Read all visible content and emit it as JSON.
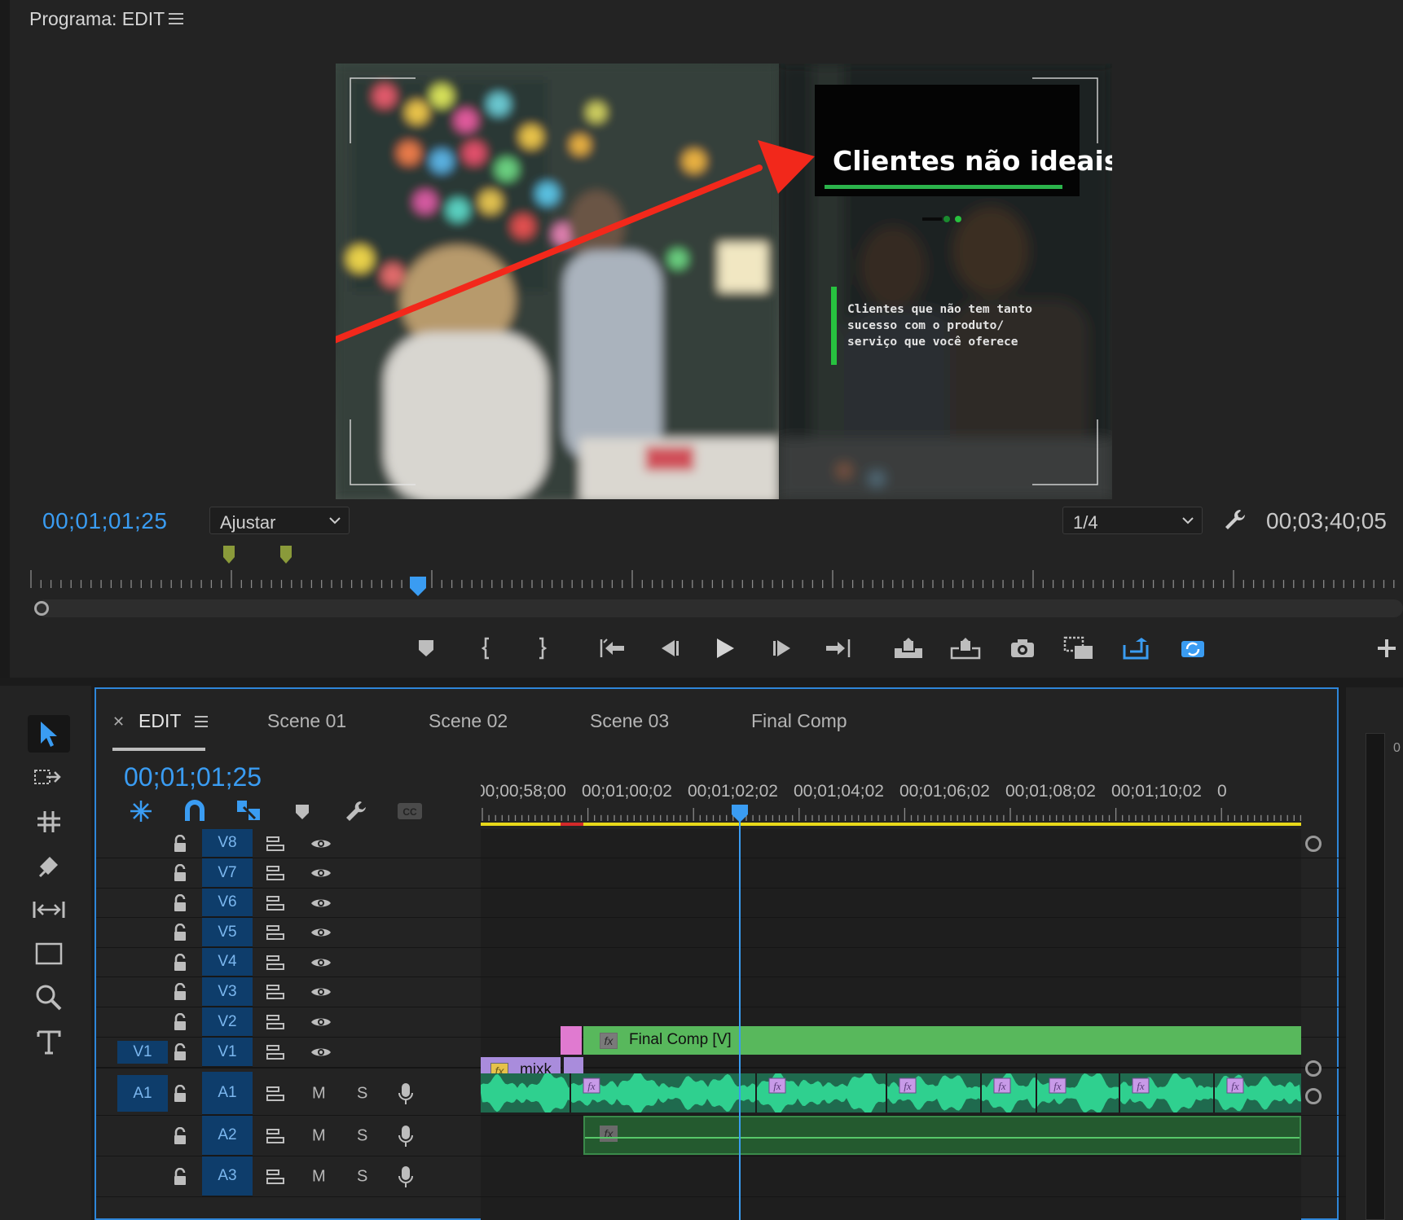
{
  "program": {
    "title": "Programa: EDIT",
    "overlay_title": "Clientes não ideais",
    "overlay_subtitle": "Clientes que não tem tanto\nsucesso com o produto/\nserviço que você oferece",
    "playhead_time": "00;01;01;25",
    "fit_option": "Ajustar",
    "resolution_option": "1/4",
    "duration_time": "00;03;40;05"
  },
  "transport_icons": [
    "add-marker-icon",
    "mark-in-icon",
    "mark-out-icon",
    "go-to-in-icon",
    "step-back-icon",
    "play-icon",
    "step-forward-icon",
    "go-to-out-icon",
    "lift-icon",
    "extract-icon",
    "export-frame-icon",
    "comparison-view-icon",
    "insert-icon",
    "overwrite-icon",
    "add-button-icon"
  ],
  "tools": [
    "selection-tool-icon",
    "track-select-tool-icon",
    "ripple-edit-tool-icon",
    "razor-tool-icon",
    "slip-tool-icon",
    "rectangle-tool-icon",
    "zoom-tool-icon",
    "type-tool-icon"
  ],
  "timeline": {
    "tabs": [
      "EDIT",
      "Scene 01",
      "Scene 02",
      "Scene 03",
      "Final Comp"
    ],
    "active_tab": "EDIT",
    "timecode": "00;01;01;25",
    "ruler_labels": [
      "00;00;58;00",
      "00;01;00;02",
      "00;01;02;02",
      "00;01;04;02",
      "00;01;06;02",
      "00;01;08;02",
      "00;01;10;02",
      "0"
    ],
    "video_tracks": [
      {
        "label": "V8"
      },
      {
        "label": "V7"
      },
      {
        "label": "V6"
      },
      {
        "label": "V5"
      },
      {
        "label": "V4"
      },
      {
        "label": "V3"
      },
      {
        "label": "V2"
      },
      {
        "label": "V1",
        "source": "V1"
      }
    ],
    "audio_tracks": [
      {
        "label": "A1",
        "source": "A1",
        "mute": "M",
        "solo": "S"
      },
      {
        "label": "A2",
        "mute": "M",
        "solo": "S"
      },
      {
        "label": "A3",
        "mute": "M",
        "solo": "S"
      }
    ],
    "clips": {
      "v2_clip": "Final Comp [V]",
      "v1_clip": "mixk",
      "fx": "fx"
    }
  },
  "meter": {
    "top_label": "0"
  },
  "colors": {
    "accent_blue": "#3a9cf2",
    "clip_green": "#58b85c",
    "clip_pink": "#e07ad0",
    "clip_purple": "#a98cdc",
    "audio_teal": "#2fd08f",
    "annotation_arrow": "#f2281b"
  }
}
